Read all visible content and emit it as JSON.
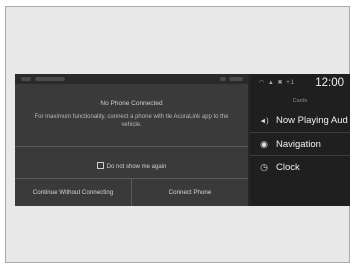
{
  "dialog": {
    "title": "No Phone Connected",
    "body": "For maximum functionality, connect a phone with tle AcuraLink app to the vehicle.",
    "checkbox_label": "Do not show me again",
    "continue_button": "Continue Without Connecting",
    "connect_button": "Connect Phone"
  },
  "status": {
    "signal_text": "+1",
    "time": "12:00"
  },
  "panel": {
    "header": "Cards",
    "items": [
      {
        "label": "Now Playing Aud",
        "icon": "speaker-icon"
      },
      {
        "label": "Navigation",
        "icon": "navigation-icon"
      },
      {
        "label": "Clock",
        "icon": "clock-icon"
      }
    ]
  },
  "colors": {
    "background": "#262626",
    "dialog": "#3a3a3a",
    "text": "#f2f2f2"
  }
}
